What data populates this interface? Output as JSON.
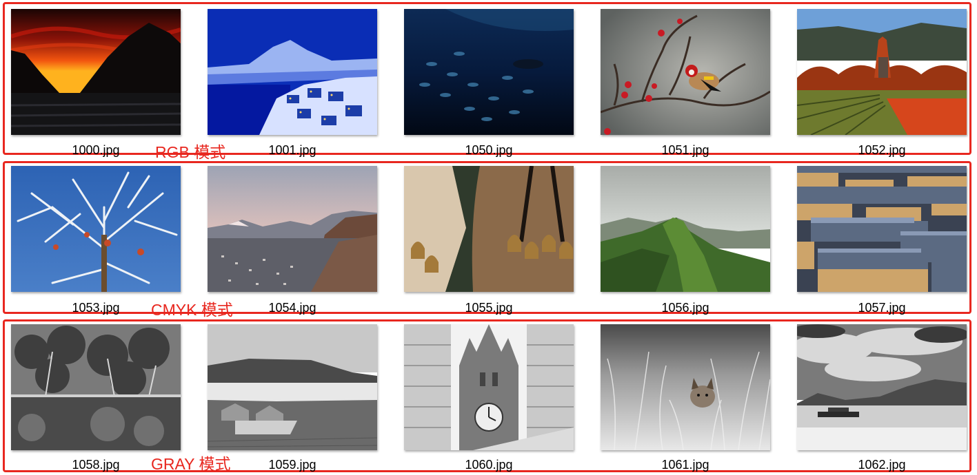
{
  "groups": [
    {
      "mode_label": "RGB 模式",
      "files": [
        {
          "name": "1000.jpg",
          "icon": "sunset-mountain-photo"
        },
        {
          "name": "1001.jpg",
          "icon": "snowy-town-night-photo"
        },
        {
          "name": "1050.jpg",
          "icon": "underwater-fish-photo"
        },
        {
          "name": "1051.jpg",
          "icon": "goldfinch-branch-photo"
        },
        {
          "name": "1052.jpg",
          "icon": "vineyard-building-photo"
        }
      ]
    },
    {
      "mode_label": "CMYK 模式",
      "files": [
        {
          "name": "1053.jpg",
          "icon": "frosted-tree-photo"
        },
        {
          "name": "1054.jpg",
          "icon": "mountain-valley-town-photo"
        },
        {
          "name": "1055.jpg",
          "icon": "bells-costume-photo"
        },
        {
          "name": "1056.jpg",
          "icon": "green-ridge-photo"
        },
        {
          "name": "1057.jpg",
          "icon": "concrete-blocks-photo"
        }
      ]
    },
    {
      "mode_label": "GRAY 模式",
      "files": [
        {
          "name": "1058.jpg",
          "icon": "forest-reflection-photo"
        },
        {
          "name": "1059.jpg",
          "icon": "coastal-ruins-photo"
        },
        {
          "name": "1060.jpg",
          "icon": "clock-tower-photo"
        },
        {
          "name": "1061.jpg",
          "icon": "lynx-grass-photo"
        },
        {
          "name": "1062.jpg",
          "icon": "lake-mountains-photo"
        }
      ]
    }
  ],
  "colors": {
    "accent": "#e8271f"
  }
}
